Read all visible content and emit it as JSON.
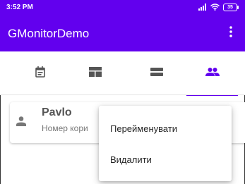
{
  "status_bar": {
    "time": "3:52 PM",
    "battery": "35"
  },
  "app_bar": {
    "title": "GMonitorDemo",
    "overflow_icon": "more-vert-icon"
  },
  "tabs": [
    {
      "icon": "calendar-icon",
      "selected": false
    },
    {
      "icon": "dashboard-icon",
      "selected": false
    },
    {
      "icon": "view-agenda-icon",
      "selected": false
    },
    {
      "icon": "people-icon",
      "selected": true
    }
  ],
  "card": {
    "name": "Pavlo",
    "subtitle": "Номер кори"
  },
  "menu": {
    "items": [
      "Перейменувати",
      "Видалити"
    ]
  },
  "colors": {
    "primary": "#6200ee",
    "icon_grey": "#555555"
  }
}
